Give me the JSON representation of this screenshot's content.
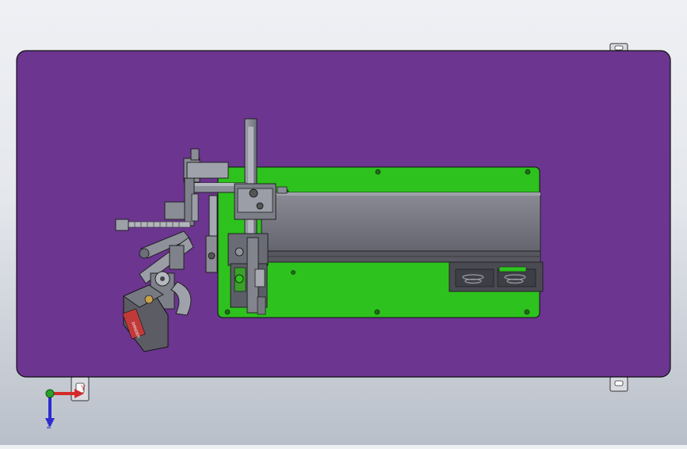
{
  "scene": {
    "background_top": "#eef0f4",
    "background_bottom": "#b9bfc9",
    "base_plate_color": "#6b3590",
    "mounting_plate_color": "#2ec21e",
    "machine_body_color": "#7a7b85"
  },
  "triad": {
    "x_label": "Y",
    "z_label": "Z",
    "x_axis_color": "#d42a2a",
    "z_axis_color": "#2c2ccf",
    "y_axis_color": "#2aa12a"
  },
  "labels": {
    "warning_tag": "DANGER"
  }
}
